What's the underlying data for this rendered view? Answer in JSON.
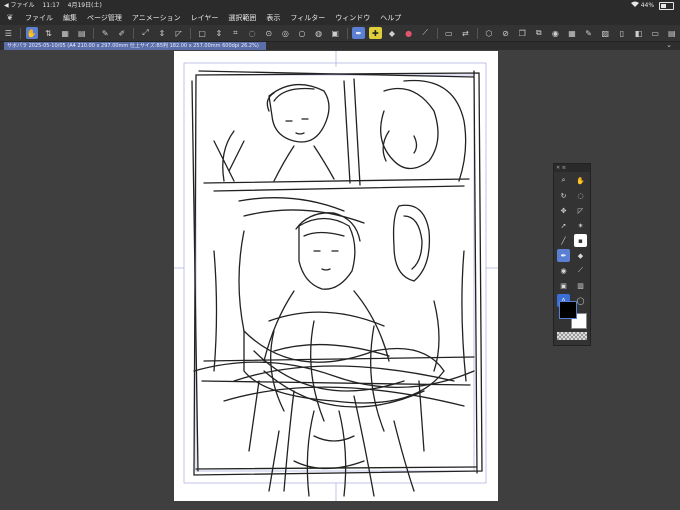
{
  "status_bar": {
    "back_label": "◀ ファイル",
    "time": "11:17",
    "date": "4月19日(土)",
    "wifi_icon": "wifi-icon",
    "battery_percent": "44%",
    "battery_level": 0.44
  },
  "menu": {
    "items": [
      "ファイル",
      "編集",
      "ページ管理",
      "アニメーション",
      "レイヤー",
      "選択範囲",
      "表示",
      "フィルター",
      "ウィンドウ",
      "ヘルプ"
    ]
  },
  "toolbar": {
    "icons": [
      "menu-icon",
      "hand-icon",
      "undo-icon",
      "sub-tool-icon",
      "brush-icon",
      "pencil-icon",
      "layer-icon",
      "transform-icon",
      "shape-icon",
      "ruler-icon",
      "select-icon",
      "lasso-icon",
      "fill-icon",
      "gradient-icon",
      "eraser-icon",
      "blend-icon",
      "text-icon",
      "color-icon",
      "eyedropper-icon",
      "move-icon",
      "layer-settings-icon",
      "reference-icon",
      "mask-icon",
      "flip-icon",
      "rotate-icon",
      "zoom-icon",
      "view-icon",
      "panel-icon"
    ]
  },
  "document": {
    "tab_title": "サボパラ 2025-05-10/05 (A4 210.00 x 297.00mm 仕上サイズ:B5判 182.00 x 257.00mm 600dpi 26.2%)"
  },
  "palette": {
    "tools": [
      "zoom-icon",
      "hand-icon",
      "rotate-icon",
      "lasso-icon",
      "move-icon",
      "shape-icon",
      "pointer-icon",
      "wand-icon",
      "line-icon",
      "frame-icon",
      "pen-icon",
      "eraser-icon",
      "brush-icon",
      "eyedropper-icon",
      "pattern-icon",
      "gradient-icon",
      "text-icon",
      "balloon-icon"
    ],
    "main_color": "#000000",
    "sub_color": "#ffffff"
  },
  "colors": {
    "accent": "#5b7fd2",
    "background": "#3f3f3f",
    "canvas": "#ffffff"
  }
}
